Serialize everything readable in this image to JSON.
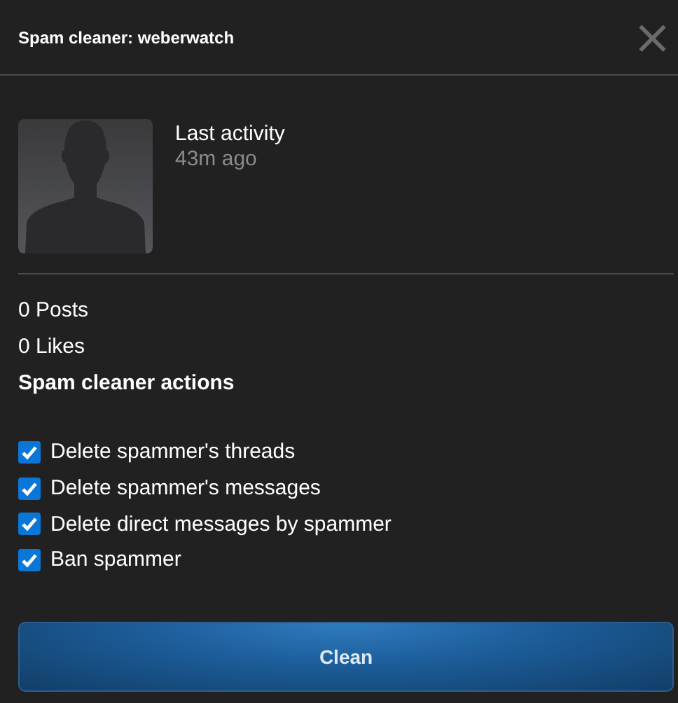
{
  "dialog": {
    "title": "Spam cleaner: weberwatch",
    "close": "×"
  },
  "user": {
    "activity_label": "Last activity",
    "activity_time": "43m ago"
  },
  "stats": [
    "0 Posts",
    "0 Likes"
  ],
  "actions_heading": "Spam cleaner actions",
  "actions": [
    {
      "label": "Delete spammer's threads",
      "checked": true
    },
    {
      "label": "Delete spammer's messages",
      "checked": true
    },
    {
      "label": "Delete direct messages by spammer",
      "checked": true
    },
    {
      "label": "Ban spammer",
      "checked": true
    }
  ],
  "button": "Clean"
}
